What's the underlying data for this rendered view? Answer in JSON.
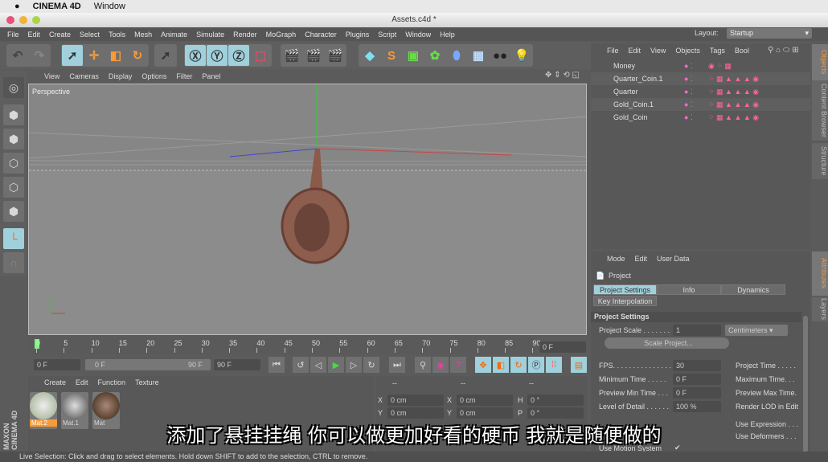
{
  "macos": {
    "app": "CINEMA 4D",
    "menu": "Window"
  },
  "window": {
    "title": "Assets.c4d *"
  },
  "menu": [
    "File",
    "Edit",
    "Create",
    "Select",
    "Tools",
    "Mesh",
    "Animate",
    "Simulate",
    "Render",
    "MoGraph",
    "Character",
    "Plugins",
    "Script",
    "Window",
    "Help"
  ],
  "layout": {
    "label": "Layout:",
    "value": "Startup"
  },
  "viewport": {
    "menu": [
      "View",
      "Cameras",
      "Display",
      "Options",
      "Filter",
      "Panel"
    ],
    "camera": "Perspective"
  },
  "timeline": {
    "ticks": [
      "0",
      "5",
      "10",
      "15",
      "20",
      "25",
      "30",
      "35",
      "40",
      "45",
      "50",
      "55",
      "60",
      "65",
      "70",
      "75",
      "80",
      "85",
      "90"
    ],
    "current": "0 F",
    "start": "0 F",
    "range_start": "0 F",
    "range_end": "90 F",
    "end": "90 F"
  },
  "materials": {
    "menu": [
      "Create",
      "Edit",
      "Function",
      "Texture"
    ],
    "items": [
      {
        "name": "Mat.2",
        "selected": true
      },
      {
        "name": "Mat.1"
      },
      {
        "name": "Mat"
      }
    ]
  },
  "coords": {
    "headers": [
      "--",
      "--",
      "--"
    ],
    "rows": [
      [
        "X",
        "0 cm",
        "X",
        "0 cm",
        "H",
        "0 °"
      ],
      [
        "Y",
        "0 cm",
        "Y",
        "0 cm",
        "P",
        "0 °"
      ]
    ]
  },
  "objects": {
    "menu": [
      "File",
      "Edit",
      "View",
      "Objects",
      "Tags",
      "Bool"
    ],
    "items": [
      "Money",
      "Quarter_Coin.1",
      "Quarter",
      "Gold_Coin.1",
      "Gold_Coin"
    ]
  },
  "right_tabs": {
    "objects": "Objects",
    "content_browser": "Content Browser",
    "structure": "Structure",
    "attributes": "Attributes",
    "layers": "Layers"
  },
  "attributes": {
    "menu": [
      "Mode",
      "Edit",
      "User Data"
    ],
    "object": "Project",
    "tabs": [
      "Project Settings",
      "Info",
      "Dynamics",
      "Key Interpolation"
    ],
    "section": "Project Settings",
    "project_scale_label": "Project Scale . . . . . . .",
    "project_scale": "1",
    "unit": "Centimeters",
    "scale_button": "Scale Project...",
    "fields": [
      {
        "label": "FPS. . . . . . . . . . . . . . . .",
        "value": "30",
        "right": "Project Time . . . . ."
      },
      {
        "label": "Minimum Time . . . . .",
        "value": "0 F",
        "right": "Maximum Time. . ."
      },
      {
        "label": "Preview Min Time . . .",
        "value": "0 F",
        "right": "Preview Max Time."
      }
    ],
    "lod_label": "Level of Detail . . . . . .",
    "lod": "100 %",
    "lod_right": "Render LOD in Edit",
    "use_expression": "Use Expression . . .",
    "use_deformers": "Use Deformers . . .",
    "use_motion": "Use Motion System"
  },
  "subtitle": "添加了悬挂挂绳 你可以做更加好看的硬币 我就是随便做的",
  "status": "Live Selection: Click and drag to select elements. Hold down SHIFT to add to the selection, CTRL to remove.",
  "logo": "MAXON CINEMA 4D"
}
